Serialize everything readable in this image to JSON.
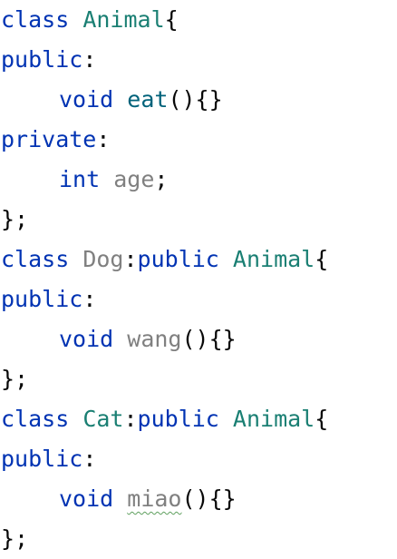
{
  "colors": {
    "keyword": "#0033b3",
    "class_name": "#1a7f73",
    "function_name": "#00627a",
    "unused_identifier": "#808080",
    "punctuation": "#080808",
    "typo_squiggle": "#5fa05f",
    "background": "#ffffff"
  },
  "code": {
    "l1": {
      "kw": "class",
      "name": "Animal",
      "punc": "{"
    },
    "l2": {
      "kw": "public",
      "punc": ":"
    },
    "l3": {
      "type": "void",
      "fn": "eat",
      "punc": "(){}"
    },
    "l4": {
      "kw": "private",
      "punc": ":"
    },
    "l5": {
      "type": "int",
      "var": "age",
      "punc": ";"
    },
    "l6": {
      "punc": "};"
    },
    "l7": {
      "kw": "class",
      "name": "Dog",
      "sep": ":",
      "kw2": "public",
      "base": "Animal",
      "punc": "{"
    },
    "l8": {
      "kw": "public",
      "punc": ":"
    },
    "l9": {
      "type": "void",
      "fn": "wang",
      "punc": "(){}"
    },
    "l10": {
      "punc": "};"
    },
    "l11": {
      "kw": "class",
      "name": "Cat",
      "sep": ":",
      "kw2": "public",
      "base": "Animal",
      "punc": "{"
    },
    "l12": {
      "kw": "public",
      "punc": ":"
    },
    "l13": {
      "type": "void",
      "fn": "miao",
      "punc": "(){}"
    },
    "l14": {
      "punc": "};"
    }
  }
}
